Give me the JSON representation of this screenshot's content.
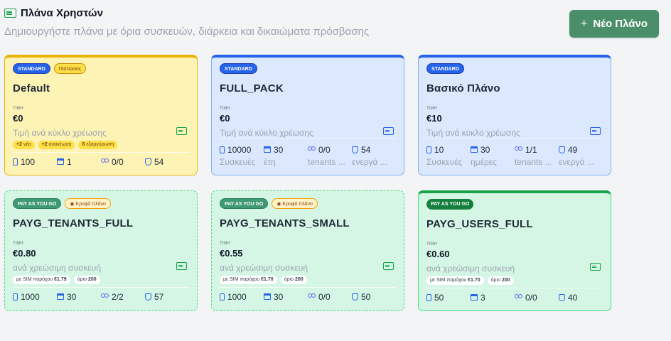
{
  "header": {
    "title": "Πλάνα Χρηστών",
    "subtitle": "Δημιουργήστε πλάνα με όρια συσκευών, διάρκεια και δικαιώματα πρόσβασης",
    "new_plan_label": "Νέο Πλάνο",
    "new_plan_icon": "plus-icon"
  },
  "price_label": "ΤΙΜΗ",
  "cards": [
    {
      "type_badge": "STANDARD",
      "extra_badge": "Πιστώσεις",
      "name": "Default",
      "price": "€0",
      "price_desc": "Τιμή ανά κύκλο χρέωσης",
      "chips": [
        {
          "strong": "+2",
          "text": "νέα"
        },
        {
          "strong": "+2",
          "text": "ανανέωση"
        },
        {
          "strong": "6",
          "text": "εξαργύρωση"
        }
      ],
      "stats": [
        {
          "value": "100",
          "sub": ""
        },
        {
          "value": "1",
          "sub": ""
        },
        {
          "value": "0/0",
          "sub": ""
        },
        {
          "value": "54",
          "sub": ""
        }
      ]
    },
    {
      "type_badge": "STANDARD",
      "name": "FULL_PACK",
      "price": "€0",
      "price_desc": "Τιμή ανά κύκλο χρέωσης",
      "stats": [
        {
          "value": "10000",
          "sub": "Συσκευές"
        },
        {
          "value": "30",
          "sub": "έτη"
        },
        {
          "value": "0/0",
          "sub": "tenants ..."
        },
        {
          "value": "54",
          "sub": "ενεργά ..."
        }
      ]
    },
    {
      "type_badge": "STANDARD",
      "name": "Βασικό Πλάνο",
      "price": "€10",
      "price_desc": "Τιμή ανά κύκλο χρέωσης",
      "stats": [
        {
          "value": "10",
          "sub": "Συσκευές"
        },
        {
          "value": "30",
          "sub": "ημέρες"
        },
        {
          "value": "1/1",
          "sub": "tenants ..."
        },
        {
          "value": "49",
          "sub": "ενεργά ..."
        }
      ]
    },
    {
      "type_badge": "PAY AS YOU GO",
      "extra_badge": "Κρυφό πλάνο",
      "name": "PAYG_TENANTS_FULL",
      "price": "€0.80",
      "price_desc": "ανά χρεώσιμη συσκευή",
      "chips": [
        {
          "text": "με SIM παρόχου",
          "strong": "€1.79"
        },
        {
          "text": "όριο",
          "strong": "200"
        }
      ],
      "stats": [
        {
          "value": "1000",
          "sub": ""
        },
        {
          "value": "30",
          "sub": ""
        },
        {
          "value": "2/2",
          "sub": ""
        },
        {
          "value": "57",
          "sub": ""
        }
      ]
    },
    {
      "type_badge": "PAY AS YOU GO",
      "extra_badge": "Κρυφό πλάνο",
      "name": "PAYG_TENANTS_SMALL",
      "price": "€0.55",
      "price_desc": "ανά χρεώσιμη συσκευή",
      "chips": [
        {
          "text": "με SIM παρόχου",
          "strong": "€1.70"
        },
        {
          "text": "όριο",
          "strong": "200"
        }
      ],
      "stats": [
        {
          "value": "1000",
          "sub": ""
        },
        {
          "value": "30",
          "sub": ""
        },
        {
          "value": "0/0",
          "sub": ""
        },
        {
          "value": "50",
          "sub": ""
        }
      ]
    },
    {
      "type_badge": "PAY AS YOU GO",
      "name": "PAYG_USERS_FULL",
      "price": "€0.60",
      "price_desc": "ανά χρεώσιμη συσκευή",
      "chips": [
        {
          "text": "με SIM παρόχου",
          "strong": "€1.70"
        },
        {
          "text": "όριο",
          "strong": "200"
        }
      ],
      "stats": [
        {
          "value": "50",
          "sub": ""
        },
        {
          "value": "3",
          "sub": ""
        },
        {
          "value": "0/0",
          "sub": ""
        },
        {
          "value": "40",
          "sub": ""
        }
      ]
    }
  ]
}
